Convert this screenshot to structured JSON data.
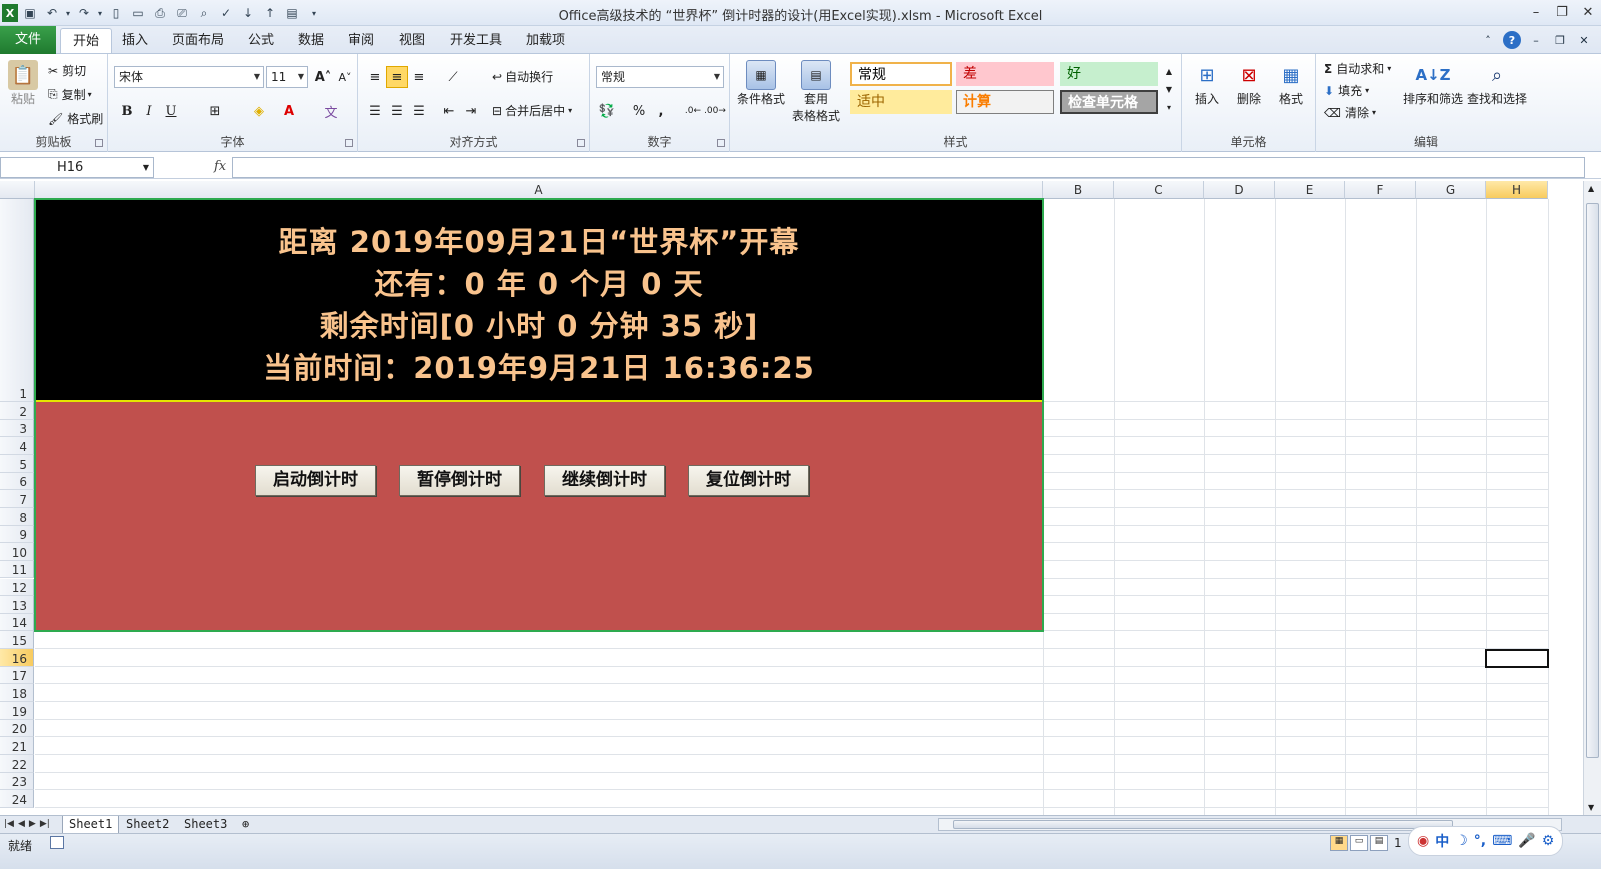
{
  "window": {
    "title": "Office高级技术的 “世界杯” 倒计时器的设计(用Excel实现).xlsm - Microsoft Excel"
  },
  "ribbon_tabs": [
    "文件",
    "开始",
    "插入",
    "页面布局",
    "公式",
    "数据",
    "审阅",
    "视图",
    "开发工具",
    "加载项"
  ],
  "active_tab": "开始",
  "clipboard": {
    "paste": "粘贴",
    "cut": "剪切",
    "copy": "复制",
    "format_painter": "格式刷",
    "label": "剪贴板"
  },
  "font": {
    "name": "宋体",
    "size": "11",
    "label": "字体",
    "bold": "B",
    "italic": "I",
    "underline": "U"
  },
  "alignment": {
    "wrap": "自动换行",
    "merge": "合并后居中",
    "label": "对齐方式"
  },
  "number": {
    "format": "常规",
    "label": "数字",
    "percent": "%",
    "comma": ","
  },
  "styles": {
    "conditional": "条件格式",
    "table_format": "套用\n表格格式",
    "table_format_l1": "套用",
    "table_format_l2": "表格格式",
    "cells": [
      {
        "text": "常规",
        "bg": "#ffffff",
        "fg": "#000000",
        "border": "#f0b24a"
      },
      {
        "text": "差",
        "bg": "#ffc7ce",
        "fg": "#c00000",
        "border": "#ffc7ce"
      },
      {
        "text": "好",
        "bg": "#c6efce",
        "fg": "#006100",
        "border": "#c6efce"
      },
      {
        "text": "适中",
        "bg": "#ffeb9c",
        "fg": "#9c6500",
        "border": "#ffeb9c"
      },
      {
        "text": "计算",
        "bg": "#f2f2f2",
        "fg": "#fa7d00",
        "border": "#7f7f7f"
      },
      {
        "text": "检查单元格",
        "bg": "#a5a5a5",
        "fg": "#ffffff",
        "border": "#3f3f3f"
      }
    ],
    "label": "样式"
  },
  "cells_group": {
    "insert": "插入",
    "delete": "删除",
    "format": "格式",
    "label": "单元格"
  },
  "editing": {
    "autosum": "自动求和",
    "fill": "填充",
    "clear": "清除",
    "sort": "排序和筛选",
    "find": "查找和选择",
    "label": "编辑"
  },
  "formula_bar": {
    "name_box": "H16",
    "fx": "fx",
    "value": ""
  },
  "columns": [
    "A",
    "B",
    "C",
    "D",
    "E",
    "F",
    "G",
    "H"
  ],
  "selected_column": "H",
  "rows": [
    "1",
    "2",
    "3",
    "4",
    "5",
    "6",
    "7",
    "8",
    "9",
    "10",
    "11",
    "12",
    "13",
    "14",
    "15",
    "16",
    "17",
    "18",
    "19",
    "20",
    "21",
    "22",
    "23",
    "24"
  ],
  "selected_row": "16",
  "countdown": {
    "line1": "距离 2019年09月21日“世界杯”开幕",
    "line2": "还有：0 年 0 个月 0 天",
    "line3": "剩余时间[0 小时 0 分钟 35 秒]",
    "line4": "当前时间：2019年9月21日 16:36:25",
    "text_color": "#f9c38d",
    "panel_color": "#c0504d"
  },
  "buttons": {
    "start": "启动倒计时",
    "pause": "暂停倒计时",
    "resume": "继续倒计时",
    "reset": "复位倒计时"
  },
  "sheets": [
    "Sheet1",
    "Sheet2",
    "Sheet3"
  ],
  "active_sheet": "Sheet1",
  "status": {
    "ready": "就绪",
    "zoom_digit": "1"
  },
  "ime": {
    "mode": "中"
  }
}
